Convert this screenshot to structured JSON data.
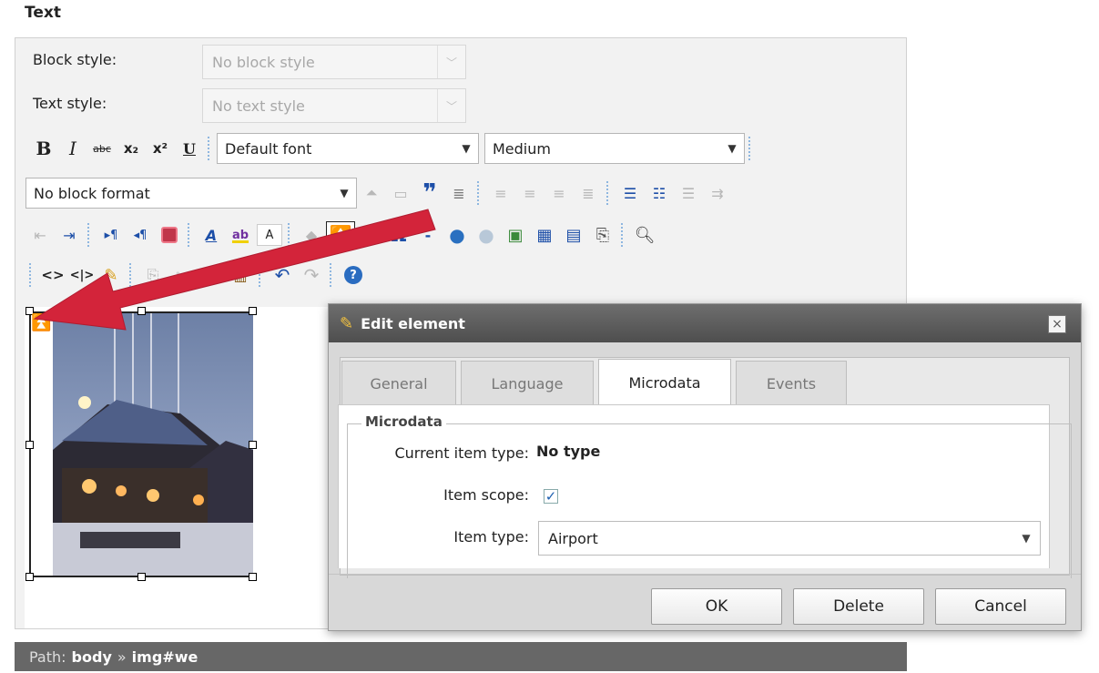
{
  "section_title": "Text",
  "block_style": {
    "label": "Block style:",
    "value": "No block style"
  },
  "text_style": {
    "label": "Text style:",
    "value": "No text style"
  },
  "toolbar": {
    "bold": "B",
    "italic": "I",
    "strike": "abc",
    "subscript": "x₂",
    "superscript": "x²",
    "underline": "U",
    "font_value": "Default font",
    "size_value": "Medium",
    "format_value": "No block format",
    "font_color": "A",
    "highlight": "ab",
    "omega": "Ω",
    "hr": "-",
    "source": "<>",
    "source2": "<|>",
    "help": "?"
  },
  "path": {
    "label": "Path:",
    "body": "body",
    "sep": "»",
    "element": "img#we"
  },
  "dialog": {
    "title": "Edit element",
    "close": "×",
    "tabs": [
      "General",
      "Language",
      "Microdata",
      "Events"
    ],
    "active_tab": "Microdata",
    "legend": "Microdata",
    "current_item_type_label": "Current item type:",
    "current_item_type_value": "No type",
    "item_scope_label": "Item scope:",
    "item_scope_checked": true,
    "item_type_label": "Item type:",
    "item_type_value": "Airport",
    "buttons": {
      "ok": "OK",
      "delete": "Delete",
      "cancel": "Cancel"
    }
  },
  "colors": {
    "arrow": "#d3243a",
    "toolbar_separator": "#8fb7e0",
    "title_bar": "#5a5a5a",
    "path_bar": "#676767"
  }
}
